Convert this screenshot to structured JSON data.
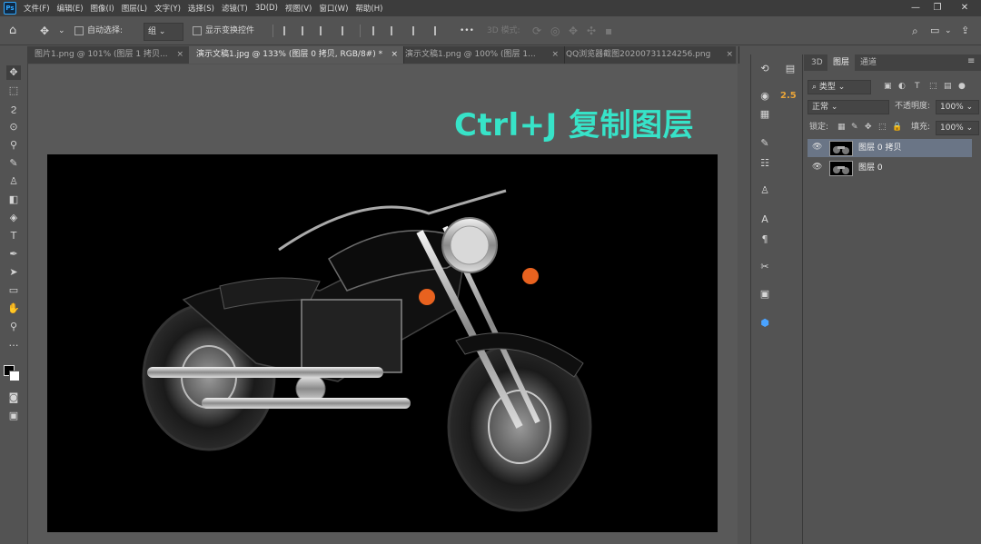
{
  "app": {
    "logo": "Ps"
  },
  "menu": [
    "文件(F)",
    "编辑(E)",
    "图像(I)",
    "图层(L)",
    "文字(Y)",
    "选择(S)",
    "滤镜(T)",
    "3D(D)",
    "视图(V)",
    "窗口(W)",
    "帮助(H)"
  ],
  "window_controls": {
    "minimize": "—",
    "restore": "❐",
    "close": "✕"
  },
  "options": {
    "auto_select_label": "自动选择:",
    "auto_select_value": "组",
    "show_transform_label": "显示变换控件",
    "more": "•••",
    "mode_3d_label": "3D 模式:"
  },
  "tabs": [
    {
      "label": "图片1.png @ 101% (图层 1 拷贝...",
      "active": false
    },
    {
      "label": "演示文稿1.jpg @ 133% (图层 0 拷贝, RGB/8#) *",
      "active": true
    },
    {
      "label": "演示文稿1.png @ 100% (图层 1...",
      "active": false
    },
    {
      "label": "QQ浏览器截图20200731124256.png",
      "active": false
    }
  ],
  "caption": "Ctrl+J 复制图层",
  "strip2_value": "2.5",
  "panel": {
    "tabs": [
      "3D",
      "图层",
      "通道"
    ],
    "active_tab": "图层",
    "filter_kind": "类型",
    "blend_mode": "正常",
    "opacity_label": "不透明度:",
    "opacity_value": "100%",
    "lock_label": "锁定:",
    "fill_label": "填充:",
    "fill_value": "100%",
    "layers": [
      {
        "name": "图层 0 拷贝",
        "selected": true
      },
      {
        "name": "图层 0",
        "selected": false
      }
    ]
  },
  "colors": {
    "accent_caption": "#37e3c8",
    "selected_layer": "#6a7586",
    "ps_blue": "#31a8ff"
  }
}
